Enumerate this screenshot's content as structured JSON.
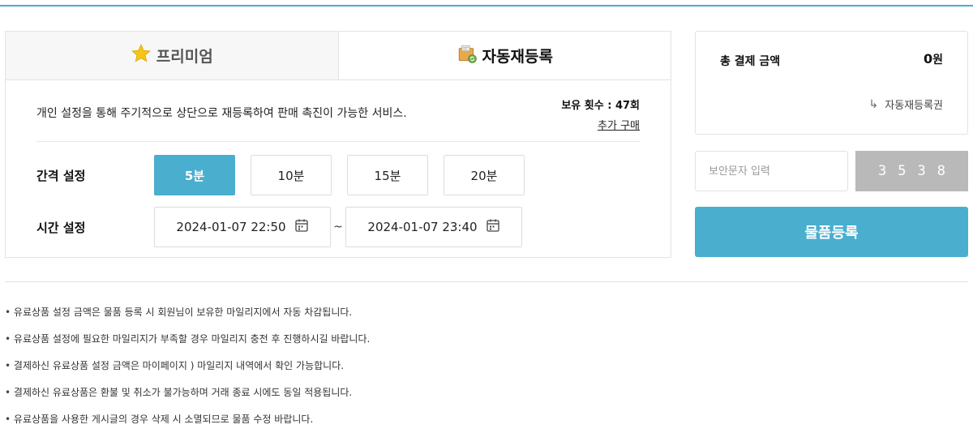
{
  "tabs": [
    {
      "label": "프리미엄",
      "icon": "star-icon"
    },
    {
      "label": "자동재등록",
      "icon": "package-refresh-icon",
      "active": true
    }
  ],
  "service": {
    "description": "개인 설정을 통해 주기적으로 상단으로 재등록하여 판매 촉진이 가능한 서비스.",
    "holdings_label": "보유 횟수 : 47회",
    "buy_more_label": "추가 구매"
  },
  "interval": {
    "label": "간격 설정",
    "options": [
      "5분",
      "10분",
      "15분",
      "20분"
    ],
    "selected": "5분"
  },
  "time": {
    "label": "시간 설정",
    "start": "2024-01-07 22:50",
    "separator": "~",
    "end": "2024-01-07 23:40"
  },
  "summary": {
    "total_label": "총 결제 금액",
    "total_amount": "0",
    "currency": "원",
    "sub_item_arrow": "↳",
    "sub_item_label": "자동재등록권"
  },
  "captcha": {
    "placeholder": "보안문자 입력",
    "code": "3538"
  },
  "register_button": "물품등록",
  "notes": [
    "유료상품 설정 금액은 물품 등록 시 회원님이 보유한 마일리지에서 자동 차감됩니다.",
    "유료상품 설정에 필요한 마일리지가 부족할 경우 마일리지 충전 후 진행하시길 바랍니다.",
    "결제하신 유료상품 설정 금액은 마이페이지 ) 마일리지 내역에서 확인 가능합니다.",
    "결제하신 유료상품은 환불 및 취소가 불가능하며 거래 종료 시에도 동일 적용됩니다.",
    "유료상품을 사용한 게시글의 경우 삭제 시 소멸되므로 물품 수정 바랍니다."
  ],
  "colors": {
    "accent": "#4aaecf",
    "captcha_bg": "#b9b9b9"
  }
}
